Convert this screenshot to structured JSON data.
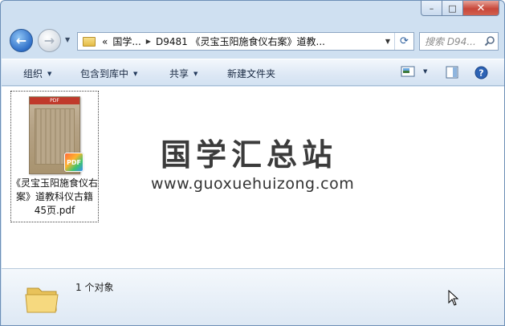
{
  "window": {
    "caption_minimize": "–",
    "caption_maximize": "□",
    "caption_close": "✕"
  },
  "nav": {
    "back_icon": "←",
    "forward_icon": "→",
    "address_prefix": "«",
    "address_segment1": "国学...",
    "address_segment2": "D9481 《灵宝玉阳施食仪右案》道教...",
    "search_placeholder": "搜索 D94..."
  },
  "toolbar": {
    "organize": "组织",
    "include_in_library": "包含到库中",
    "share": "共享",
    "new_folder": "新建文件夹"
  },
  "files": [
    {
      "name": "《灵宝玉阳施食仪右案》道教科仪古籍 45页.pdf",
      "badge": "PDF",
      "thumb_bar": "PDF"
    }
  ],
  "watermark": {
    "title": "国学汇总站",
    "url": "www.guoxuehuizong.com"
  },
  "details": {
    "count_text": "1 个对象"
  },
  "colors": {
    "frame": "#cfe0f1",
    "close_button": "#c8473a",
    "accent_blue": "#2f6fc8"
  }
}
